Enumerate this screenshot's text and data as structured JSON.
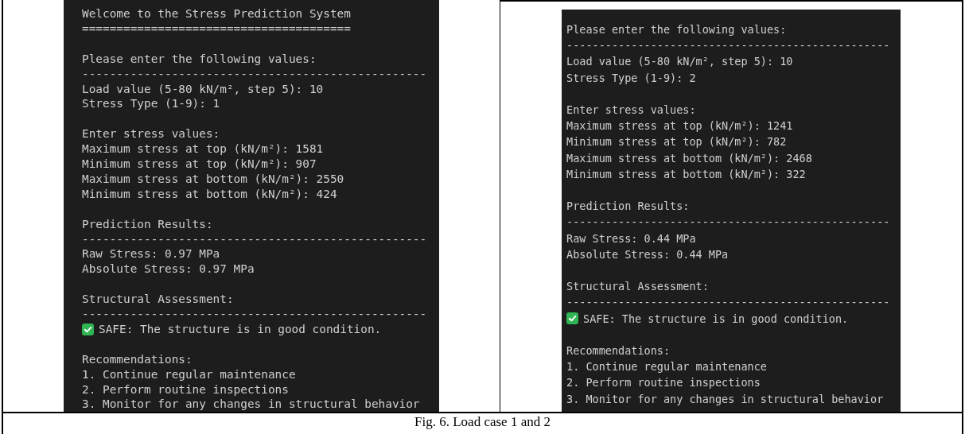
{
  "panels": [
    {
      "lines": [
        {
          "kind": "text",
          "text": "Welcome to the Stress Prediction System"
        },
        {
          "kind": "text",
          "text": "======================================="
        },
        {
          "kind": "blank"
        },
        {
          "kind": "text",
          "text": "Please enter the following values:"
        },
        {
          "kind": "text",
          "text": "--------------------------------------------------"
        },
        {
          "kind": "text",
          "text": "Load value (5-80 kN/m², step 5): 10"
        },
        {
          "kind": "text",
          "text": "Stress Type (1-9): 1"
        },
        {
          "kind": "blank"
        },
        {
          "kind": "text",
          "text": "Enter stress values:"
        },
        {
          "kind": "text",
          "text": "Maximum stress at top (kN/m²): 1581"
        },
        {
          "kind": "text",
          "text": "Minimum stress at top (kN/m²): 907"
        },
        {
          "kind": "text",
          "text": "Maximum stress at bottom (kN/m²): 2550"
        },
        {
          "kind": "text",
          "text": "Minimum stress at bottom (kN/m²): 424"
        },
        {
          "kind": "blank"
        },
        {
          "kind": "text",
          "text": "Prediction Results:"
        },
        {
          "kind": "text",
          "text": "--------------------------------------------------"
        },
        {
          "kind": "text",
          "text": "Raw Stress: 0.97 MPa"
        },
        {
          "kind": "text",
          "text": "Absolute Stress: 0.97 MPa"
        },
        {
          "kind": "blank"
        },
        {
          "kind": "text",
          "text": "Structural Assessment:"
        },
        {
          "kind": "text",
          "text": "--------------------------------------------------"
        },
        {
          "kind": "status",
          "text": "SAFE: The structure is in good condition."
        },
        {
          "kind": "blank"
        },
        {
          "kind": "text",
          "text": "Recommendations:"
        },
        {
          "kind": "text",
          "text": "1. Continue regular maintenance"
        },
        {
          "kind": "text",
          "text": "2. Perform routine inspections"
        },
        {
          "kind": "text",
          "text": "3. Monitor for any changes in structural behavior"
        }
      ]
    },
    {
      "lines": [
        {
          "kind": "text",
          "text": "Please enter the following values:"
        },
        {
          "kind": "text",
          "text": "--------------------------------------------------"
        },
        {
          "kind": "text",
          "text": "Load value (5-80 kN/m², step 5): 10"
        },
        {
          "kind": "text",
          "text": "Stress Type (1-9): 2"
        },
        {
          "kind": "blank"
        },
        {
          "kind": "text",
          "text": "Enter stress values:"
        },
        {
          "kind": "text",
          "text": "Maximum stress at top (kN/m²): 1241"
        },
        {
          "kind": "text",
          "text": "Minimum stress at top (kN/m²): 782"
        },
        {
          "kind": "text",
          "text": "Maximum stress at bottom (kN/m²): 2468"
        },
        {
          "kind": "text",
          "text": "Minimum stress at bottom (kN/m²): 322"
        },
        {
          "kind": "blank"
        },
        {
          "kind": "text",
          "text": "Prediction Results:"
        },
        {
          "kind": "text",
          "text": "--------------------------------------------------"
        },
        {
          "kind": "text",
          "text": "Raw Stress: 0.44 MPa"
        },
        {
          "kind": "text",
          "text": "Absolute Stress: 0.44 MPa"
        },
        {
          "kind": "blank"
        },
        {
          "kind": "text",
          "text": "Structural Assessment:"
        },
        {
          "kind": "text",
          "text": "--------------------------------------------------"
        },
        {
          "kind": "status",
          "text": "SAFE: The structure is in good condition."
        },
        {
          "kind": "blank"
        },
        {
          "kind": "text",
          "text": "Recommendations:"
        },
        {
          "kind": "text",
          "text": "1. Continue regular maintenance"
        },
        {
          "kind": "text",
          "text": "2. Perform routine inspections"
        },
        {
          "kind": "text",
          "text": "3. Monitor for any changes in structural behavior"
        }
      ]
    }
  ],
  "caption": "Fig. 6. Load case 1 and 2"
}
